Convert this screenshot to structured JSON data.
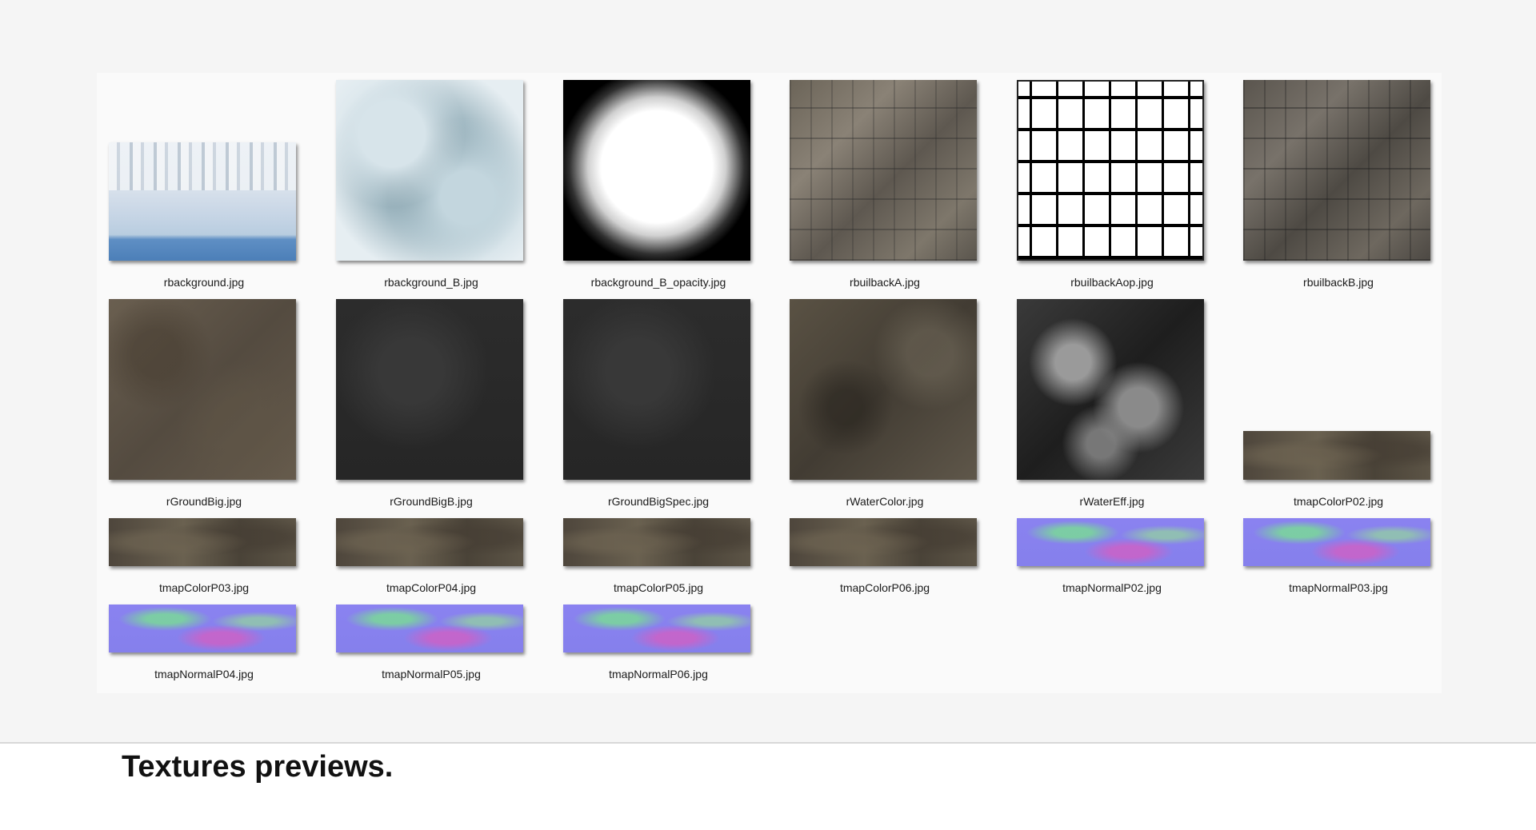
{
  "caption": "Textures previews.",
  "thumbnails": [
    {
      "label": "rbackground.jpg",
      "icon": "image-thumbnail-icon"
    },
    {
      "label": "rbackground_B.jpg",
      "icon": "image-thumbnail-icon"
    },
    {
      "label": "rbackground_B_opacity.jpg",
      "icon": "image-thumbnail-icon"
    },
    {
      "label": "rbuilbackA.jpg",
      "icon": "image-thumbnail-icon"
    },
    {
      "label": "rbuilbackAop.jpg",
      "icon": "image-thumbnail-icon"
    },
    {
      "label": "rbuilbackB.jpg",
      "icon": "image-thumbnail-icon"
    },
    {
      "label": "rGroundBig.jpg",
      "icon": "image-thumbnail-icon"
    },
    {
      "label": "rGroundBigB.jpg",
      "icon": "image-thumbnail-icon"
    },
    {
      "label": "rGroundBigSpec.jpg",
      "icon": "image-thumbnail-icon"
    },
    {
      "label": "rWaterColor.jpg",
      "icon": "image-thumbnail-icon"
    },
    {
      "label": "rWaterEff.jpg",
      "icon": "image-thumbnail-icon"
    },
    {
      "label": "tmapColorP02.jpg",
      "icon": "image-thumbnail-icon"
    },
    {
      "label": "tmapColorP03.jpg",
      "icon": "image-thumbnail-icon"
    },
    {
      "label": "tmapColorP04.jpg",
      "icon": "image-thumbnail-icon"
    },
    {
      "label": "tmapColorP05.jpg",
      "icon": "image-thumbnail-icon"
    },
    {
      "label": "tmapColorP06.jpg",
      "icon": "image-thumbnail-icon"
    },
    {
      "label": "tmapNormalP02.jpg",
      "icon": "image-thumbnail-icon"
    },
    {
      "label": "tmapNormalP03.jpg",
      "icon": "image-thumbnail-icon"
    },
    {
      "label": "tmapNormalP04.jpg",
      "icon": "image-thumbnail-icon"
    },
    {
      "label": "tmapNormalP05.jpg",
      "icon": "image-thumbnail-icon"
    },
    {
      "label": "tmapNormalP06.jpg",
      "icon": "image-thumbnail-icon"
    }
  ]
}
